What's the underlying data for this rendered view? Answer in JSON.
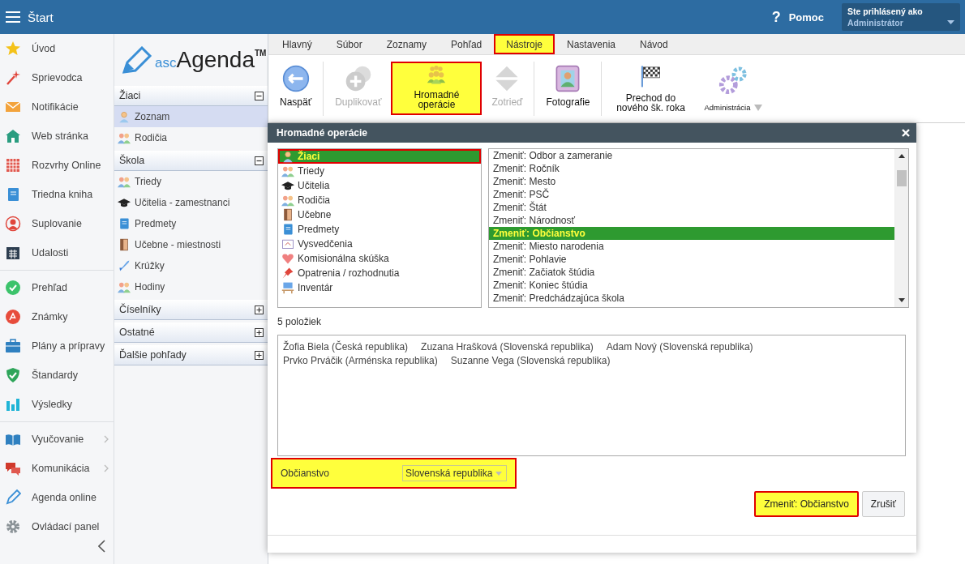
{
  "topbar": {
    "title": "Štart",
    "help_icon": "?",
    "help": "Pomoc",
    "user_label": "Ste prihlásený ako",
    "user_name": "Administrátor"
  },
  "nav": {
    "groups": [
      {
        "items": [
          {
            "label": "Úvod",
            "submenu": false
          },
          {
            "label": "Sprievodca",
            "submenu": false
          },
          {
            "label": "Notifikácie",
            "submenu": false
          },
          {
            "label": "Web stránka",
            "submenu": false
          },
          {
            "label": "Rozvrhy Online",
            "submenu": false
          },
          {
            "label": "Triedna kniha",
            "submenu": false
          },
          {
            "label": "Suplovanie",
            "submenu": false
          },
          {
            "label": "Udalosti",
            "submenu": false
          }
        ]
      },
      {
        "items": [
          {
            "label": "Prehľad",
            "submenu": false
          },
          {
            "label": "Známky",
            "submenu": false
          },
          {
            "label": "Plány a prípravy",
            "submenu": false
          },
          {
            "label": "Štandardy",
            "submenu": false
          },
          {
            "label": "Výsledky",
            "submenu": false
          }
        ]
      },
      {
        "items": [
          {
            "label": "Vyučovanie",
            "submenu": true
          },
          {
            "label": "Komunikácia",
            "submenu": true
          },
          {
            "label": "Agenda online",
            "submenu": false
          },
          {
            "label": "Ovládací panel",
            "submenu": false
          }
        ]
      }
    ]
  },
  "panel": {
    "logo": {
      "prefix": "asc",
      "name": "Agenda",
      "mark": "TM"
    },
    "sections": [
      {
        "title": "Žiaci",
        "expanded": true,
        "items": [
          {
            "label": "Zoznam",
            "selected": true
          },
          {
            "label": "Rodičia",
            "selected": false
          }
        ]
      },
      {
        "title": "Škola",
        "expanded": true,
        "items": [
          {
            "label": "Triedy",
            "selected": false
          },
          {
            "label": "Učitelia - zamestnanci",
            "selected": false
          },
          {
            "label": "Predmety",
            "selected": false
          },
          {
            "label": "Učebne - miestnosti",
            "selected": false
          },
          {
            "label": "Krúžky",
            "selected": false
          },
          {
            "label": "Hodiny",
            "selected": false
          }
        ]
      },
      {
        "title": "Číselníky",
        "expanded": false
      },
      {
        "title": "Ostatné",
        "expanded": false
      },
      {
        "title": "Ďalšie pohľady",
        "expanded": false
      }
    ]
  },
  "ribbon": {
    "tabs": [
      {
        "label": "Hlavný",
        "selected": false
      },
      {
        "label": "Súbor",
        "selected": false
      },
      {
        "label": "Zoznamy",
        "selected": false
      },
      {
        "label": "Pohľad",
        "selected": false
      },
      {
        "label": "Nástroje",
        "selected": true
      },
      {
        "label": "Nastavenia",
        "selected": false
      },
      {
        "label": "Návod",
        "selected": false
      }
    ],
    "groups": [
      {
        "buttons": [
          {
            "label": "Naspäť",
            "disabled": false,
            "highlighted": false
          }
        ]
      },
      {
        "buttons": [
          {
            "label": "Duplikovať",
            "disabled": true,
            "highlighted": false
          },
          {
            "label": "Hromadné operácie",
            "disabled": false,
            "highlighted": true
          },
          {
            "label": "Zotrieď",
            "disabled": true,
            "highlighted": false
          }
        ]
      },
      {
        "buttons": [
          {
            "label": "Fotografie",
            "disabled": false,
            "highlighted": false
          }
        ]
      },
      {
        "buttons": [
          {
            "label": "Prechod do nového šk. roka",
            "disabled": false,
            "highlighted": false
          },
          {
            "label": "Administrácia",
            "disabled": false,
            "highlighted": false,
            "dropdown": true
          }
        ]
      }
    ]
  },
  "dialog": {
    "title": "Hromadné operácie",
    "categories": [
      {
        "label": "Žiaci",
        "selected": true
      },
      {
        "label": "Triedy",
        "selected": false
      },
      {
        "label": "Učitelia",
        "selected": false
      },
      {
        "label": "Rodičia",
        "selected": false
      },
      {
        "label": "Učebne",
        "selected": false
      },
      {
        "label": "Predmety",
        "selected": false
      },
      {
        "label": "Vysvedčenia",
        "selected": false
      },
      {
        "label": "Komisionálna skúška",
        "selected": false
      },
      {
        "label": "Opatrenia / rozhodnutia",
        "selected": false
      },
      {
        "label": "Inventár",
        "selected": false
      }
    ],
    "operations": [
      {
        "label": "Zmeniť: Odbor a zameranie",
        "selected": false
      },
      {
        "label": "Zmeniť: Ročník",
        "selected": false
      },
      {
        "label": "Zmeniť: Mesto",
        "selected": false
      },
      {
        "label": "Zmeniť: PSČ",
        "selected": false
      },
      {
        "label": "Zmeniť: Štát",
        "selected": false
      },
      {
        "label": "Zmeniť: Národnosť",
        "selected": false
      },
      {
        "label": "Zmeniť: Občianstvo",
        "selected": true
      },
      {
        "label": "Zmeniť: Miesto narodenia",
        "selected": false
      },
      {
        "label": "Zmeniť: Pohlavie",
        "selected": false
      },
      {
        "label": "Zmeniť: Začiatok štúdia",
        "selected": false
      },
      {
        "label": "Zmeniť: Koniec štúdia",
        "selected": false
      },
      {
        "label": "Zmeniť: Predchádzajúca škola",
        "selected": false
      }
    ],
    "count": "5 položiek",
    "students": [
      "Žofia Biela (Česká republika)",
      "Zuzana Hrašková (Slovenská republika)",
      "Adam Nový (Slovenská republika)",
      "Prvko Prváčik (Arménska republika)",
      "Suzanne Vega (Slovenská republika)"
    ],
    "field": {
      "label": "Občianstvo",
      "value": "Slovenská republika",
      "highlighted": true
    },
    "buttons": [
      {
        "label": "Zmeniť: Občianstvo",
        "highlighted": true
      },
      {
        "label": "Zrušiť",
        "highlighted": false
      }
    ]
  }
}
